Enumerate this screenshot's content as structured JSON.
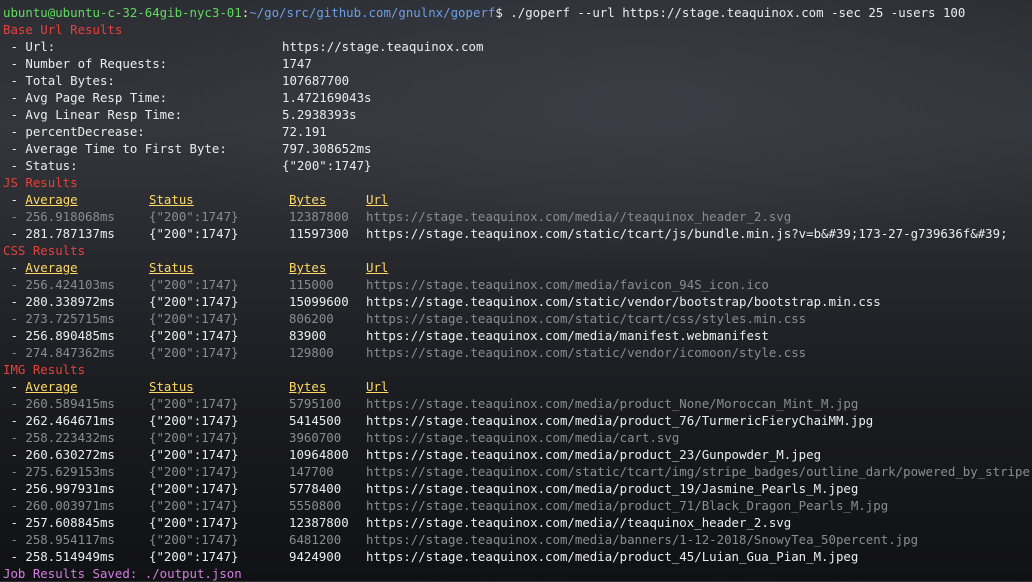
{
  "prompt": {
    "user_host": "ubuntu@ubuntu-c-32-64gib-nyc3-01",
    "path": "~/go/src/github.com/gnulnx/goperf",
    "command": "$ ./goperf --url https://stage.teaquinox.com -sec 25 -users 100"
  },
  "base": {
    "title": "Base Url Results",
    "rows": [
      {
        "key": " - Url:",
        "value": "https://stage.teaquinox.com"
      },
      {
        "key": " - Number of Requests:",
        "value": "1747"
      },
      {
        "key": " - Total Bytes:",
        "value": "107687700"
      },
      {
        "key": " - Avg Page Resp Time:",
        "value": "1.472169043s"
      },
      {
        "key": " - Avg Linear Resp Time:",
        "value": "5.2938393s"
      },
      {
        "key": " - percentDecrease:",
        "value": "72.191"
      },
      {
        "key": " - Average Time to First Byte:",
        "value": "797.308652ms"
      },
      {
        "key": " - Status:",
        "value": "{\"200\":1747}"
      }
    ]
  },
  "headers": {
    "dash": " - ",
    "average": "Average",
    "status": "Status",
    "bytes": "Bytes",
    "url": "Url"
  },
  "js": {
    "title": "JS Results",
    "rows": [
      {
        "avg": " - 256.918068ms",
        "status": "{\"200\":1747}",
        "bytes": "12387800",
        "url": "https://stage.teaquinox.com/media//teaquinox_header_2.svg",
        "dim": true
      },
      {
        "avg": " - 281.787137ms",
        "status": "{\"200\":1747}",
        "bytes": "11597300",
        "url": "https://stage.teaquinox.com/static/tcart/js/bundle.min.js?v=b&#39;173-27-g739636f&#39;",
        "dim": false
      }
    ]
  },
  "css": {
    "title": "CSS Results",
    "rows": [
      {
        "avg": " - 256.424103ms",
        "status": "{\"200\":1747}",
        "bytes": "115000",
        "url": "https://stage.teaquinox.com/media/favicon_94S_icon.ico",
        "dim": true
      },
      {
        "avg": " - 280.338972ms",
        "status": "{\"200\":1747}",
        "bytes": "15099600",
        "url": "https://stage.teaquinox.com/static/vendor/bootstrap/bootstrap.min.css",
        "dim": false
      },
      {
        "avg": " - 273.725715ms",
        "status": "{\"200\":1747}",
        "bytes": "806200",
        "url": "https://stage.teaquinox.com/static/tcart/css/styles.min.css",
        "dim": true
      },
      {
        "avg": " - 256.890485ms",
        "status": "{\"200\":1747}",
        "bytes": "83900",
        "url": "https://stage.teaquinox.com/media/manifest.webmanifest",
        "dim": false
      },
      {
        "avg": " - 274.847362ms",
        "status": "{\"200\":1747}",
        "bytes": "129800",
        "url": "https://stage.teaquinox.com/static/vendor/icomoon/style.css",
        "dim": true
      }
    ]
  },
  "img": {
    "title": "IMG Results",
    "rows": [
      {
        "avg": " - 260.589415ms",
        "status": "{\"200\":1747}",
        "bytes": "5795100",
        "url": "https://stage.teaquinox.com/media/product_None/Moroccan_Mint_M.jpg",
        "dim": true
      },
      {
        "avg": " - 262.464671ms",
        "status": "{\"200\":1747}",
        "bytes": "5414500",
        "url": "https://stage.teaquinox.com/media/product_76/TurmericFieryChaiMM.jpg",
        "dim": false
      },
      {
        "avg": " - 258.223432ms",
        "status": "{\"200\":1747}",
        "bytes": "3960700",
        "url": "https://stage.teaquinox.com/media/cart.svg",
        "dim": true
      },
      {
        "avg": " - 260.630272ms",
        "status": "{\"200\":1747}",
        "bytes": "10964800",
        "url": "https://stage.teaquinox.com/media/product_23/Gunpowder_M.jpeg",
        "dim": false
      },
      {
        "avg": " - 275.629153ms",
        "status": "{\"200\":1747}",
        "bytes": "147700",
        "url": "https://stage.teaquinox.com/static/tcart/img/stripe_badges/outline_dark/powered_by_stripe.png",
        "dim": true
      },
      {
        "avg": " - 256.997931ms",
        "status": "{\"200\":1747}",
        "bytes": "5778400",
        "url": "https://stage.teaquinox.com/media/product_19/Jasmine_Pearls_M.jpeg",
        "dim": false
      },
      {
        "avg": " - 260.003971ms",
        "status": "{\"200\":1747}",
        "bytes": "5550800",
        "url": "https://stage.teaquinox.com/media/product_71/Black_Dragon_Pearls_M.jpg",
        "dim": true
      },
      {
        "avg": " - 257.608845ms",
        "status": "{\"200\":1747}",
        "bytes": "12387800",
        "url": "https://stage.teaquinox.com/media//teaquinox_header_2.svg",
        "dim": false
      },
      {
        "avg": " - 258.954117ms",
        "status": "{\"200\":1747}",
        "bytes": "6481200",
        "url": "https://stage.teaquinox.com/media/banners/1-12-2018/SnowyTea_50percent.jpg",
        "dim": true
      },
      {
        "avg": " - 258.514949ms",
        "status": "{\"200\":1747}",
        "bytes": "9424900",
        "url": "https://stage.teaquinox.com/media/product_45/Luian_Gua_Pian_M.jpeg",
        "dim": false
      }
    ]
  },
  "footer": {
    "saved": "Job Results Saved: ./output.json"
  },
  "colors": {
    "prompt_user": "#5fdc5f",
    "prompt_path": "#6e9fe6",
    "section_title": "#e8403a",
    "header": "#ffd966",
    "dim_row": "#8a8c90",
    "saved": "#d47ee0"
  }
}
